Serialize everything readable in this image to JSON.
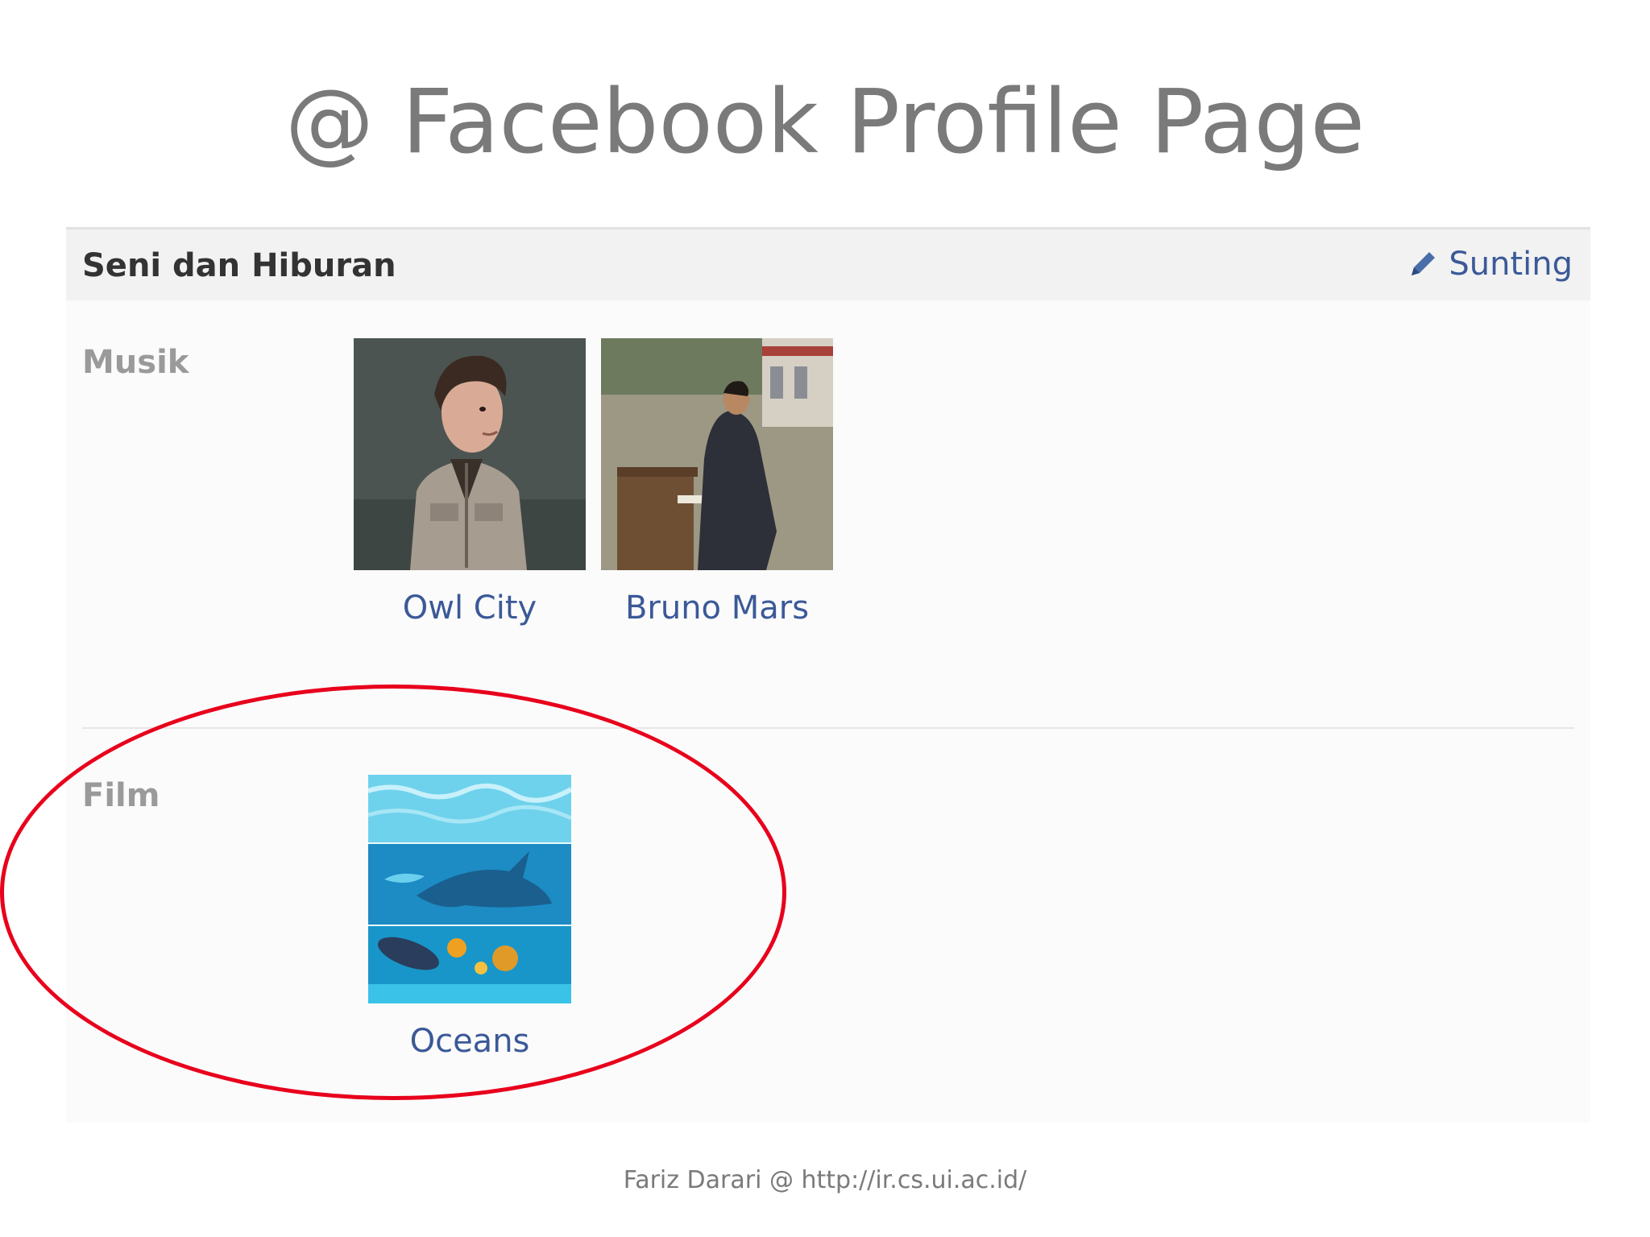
{
  "slide": {
    "title": "@ Facebook Profile Page",
    "footer": "Fariz Darari @ http://ir.cs.ui.ac.id/"
  },
  "panel": {
    "header_title": "Seni dan Hiburan",
    "edit_label": "Sunting",
    "edit_icon": "pencil-icon",
    "link_color": "#3b5998",
    "highlight_color": "#e8001c",
    "sections": [
      {
        "label": "Musik",
        "items": [
          {
            "label": "Owl City"
          },
          {
            "label": "Bruno Mars"
          }
        ]
      },
      {
        "label": "Film",
        "items": [
          {
            "label": "Oceans"
          }
        ]
      }
    ]
  }
}
